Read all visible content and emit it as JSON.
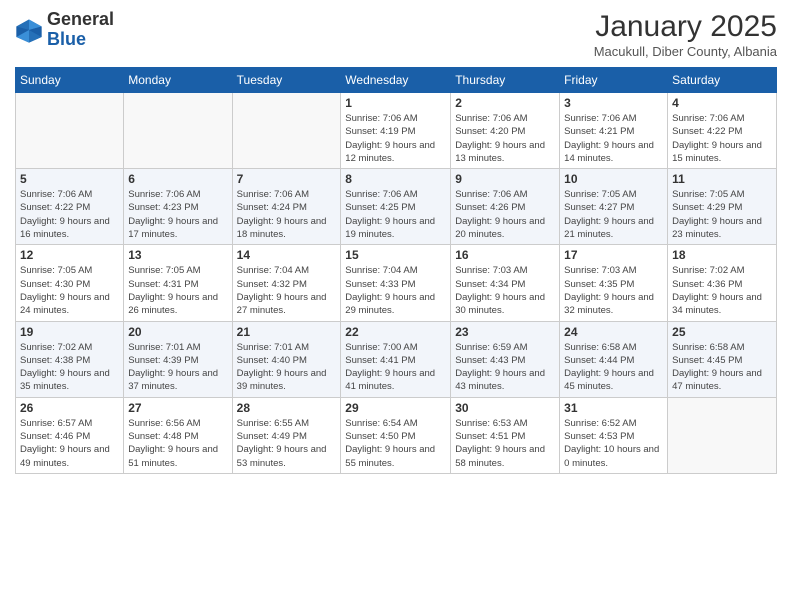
{
  "header": {
    "logo_text_general": "General",
    "logo_text_blue": "Blue",
    "month_title": "January 2025",
    "subtitle": "Macukull, Diber County, Albania"
  },
  "weekdays": [
    "Sunday",
    "Monday",
    "Tuesday",
    "Wednesday",
    "Thursday",
    "Friday",
    "Saturday"
  ],
  "weeks": [
    [
      {
        "day": "",
        "empty": true
      },
      {
        "day": "",
        "empty": true
      },
      {
        "day": "",
        "empty": true
      },
      {
        "day": "1",
        "sunrise": "7:06 AM",
        "sunset": "4:19 PM",
        "daylight": "9 hours and 12 minutes."
      },
      {
        "day": "2",
        "sunrise": "7:06 AM",
        "sunset": "4:20 PM",
        "daylight": "9 hours and 13 minutes."
      },
      {
        "day": "3",
        "sunrise": "7:06 AM",
        "sunset": "4:21 PM",
        "daylight": "9 hours and 14 minutes."
      },
      {
        "day": "4",
        "sunrise": "7:06 AM",
        "sunset": "4:22 PM",
        "daylight": "9 hours and 15 minutes."
      }
    ],
    [
      {
        "day": "5",
        "sunrise": "7:06 AM",
        "sunset": "4:22 PM",
        "daylight": "9 hours and 16 minutes."
      },
      {
        "day": "6",
        "sunrise": "7:06 AM",
        "sunset": "4:23 PM",
        "daylight": "9 hours and 17 minutes."
      },
      {
        "day": "7",
        "sunrise": "7:06 AM",
        "sunset": "4:24 PM",
        "daylight": "9 hours and 18 minutes."
      },
      {
        "day": "8",
        "sunrise": "7:06 AM",
        "sunset": "4:25 PM",
        "daylight": "9 hours and 19 minutes."
      },
      {
        "day": "9",
        "sunrise": "7:06 AM",
        "sunset": "4:26 PM",
        "daylight": "9 hours and 20 minutes."
      },
      {
        "day": "10",
        "sunrise": "7:05 AM",
        "sunset": "4:27 PM",
        "daylight": "9 hours and 21 minutes."
      },
      {
        "day": "11",
        "sunrise": "7:05 AM",
        "sunset": "4:29 PM",
        "daylight": "9 hours and 23 minutes."
      }
    ],
    [
      {
        "day": "12",
        "sunrise": "7:05 AM",
        "sunset": "4:30 PM",
        "daylight": "9 hours and 24 minutes."
      },
      {
        "day": "13",
        "sunrise": "7:05 AM",
        "sunset": "4:31 PM",
        "daylight": "9 hours and 26 minutes."
      },
      {
        "day": "14",
        "sunrise": "7:04 AM",
        "sunset": "4:32 PM",
        "daylight": "9 hours and 27 minutes."
      },
      {
        "day": "15",
        "sunrise": "7:04 AM",
        "sunset": "4:33 PM",
        "daylight": "9 hours and 29 minutes."
      },
      {
        "day": "16",
        "sunrise": "7:03 AM",
        "sunset": "4:34 PM",
        "daylight": "9 hours and 30 minutes."
      },
      {
        "day": "17",
        "sunrise": "7:03 AM",
        "sunset": "4:35 PM",
        "daylight": "9 hours and 32 minutes."
      },
      {
        "day": "18",
        "sunrise": "7:02 AM",
        "sunset": "4:36 PM",
        "daylight": "9 hours and 34 minutes."
      }
    ],
    [
      {
        "day": "19",
        "sunrise": "7:02 AM",
        "sunset": "4:38 PM",
        "daylight": "9 hours and 35 minutes."
      },
      {
        "day": "20",
        "sunrise": "7:01 AM",
        "sunset": "4:39 PM",
        "daylight": "9 hours and 37 minutes."
      },
      {
        "day": "21",
        "sunrise": "7:01 AM",
        "sunset": "4:40 PM",
        "daylight": "9 hours and 39 minutes."
      },
      {
        "day": "22",
        "sunrise": "7:00 AM",
        "sunset": "4:41 PM",
        "daylight": "9 hours and 41 minutes."
      },
      {
        "day": "23",
        "sunrise": "6:59 AM",
        "sunset": "4:43 PM",
        "daylight": "9 hours and 43 minutes."
      },
      {
        "day": "24",
        "sunrise": "6:58 AM",
        "sunset": "4:44 PM",
        "daylight": "9 hours and 45 minutes."
      },
      {
        "day": "25",
        "sunrise": "6:58 AM",
        "sunset": "4:45 PM",
        "daylight": "9 hours and 47 minutes."
      }
    ],
    [
      {
        "day": "26",
        "sunrise": "6:57 AM",
        "sunset": "4:46 PM",
        "daylight": "9 hours and 49 minutes."
      },
      {
        "day": "27",
        "sunrise": "6:56 AM",
        "sunset": "4:48 PM",
        "daylight": "9 hours and 51 minutes."
      },
      {
        "day": "28",
        "sunrise": "6:55 AM",
        "sunset": "4:49 PM",
        "daylight": "9 hours and 53 minutes."
      },
      {
        "day": "29",
        "sunrise": "6:54 AM",
        "sunset": "4:50 PM",
        "daylight": "9 hours and 55 minutes."
      },
      {
        "day": "30",
        "sunrise": "6:53 AM",
        "sunset": "4:51 PM",
        "daylight": "9 hours and 58 minutes."
      },
      {
        "day": "31",
        "sunrise": "6:52 AM",
        "sunset": "4:53 PM",
        "daylight": "10 hours and 0 minutes."
      },
      {
        "day": "",
        "empty": true
      }
    ]
  ]
}
